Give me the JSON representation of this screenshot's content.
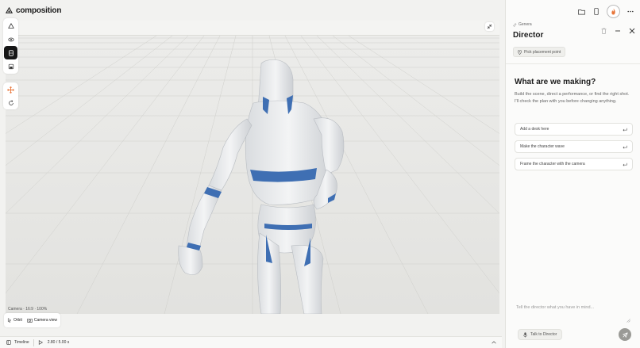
{
  "app": {
    "title": "composition"
  },
  "viewport": {
    "camera_label": "Camera · 16:9 · 100%"
  },
  "view_controls": {
    "orbit_label": "Orbit",
    "camera_view_label": "Camera view"
  },
  "timeline": {
    "label": "Timeline",
    "time": "2.80 / 5.00 s"
  },
  "panel": {
    "breadcrumb": "Genera",
    "title": "Director",
    "pick_label": "Pick placement point",
    "hero_title": "What are we making?",
    "hero_body": "Build the scene, direct a performance, or find the right shot. I'll check the plan with you before changing anything.",
    "suggestions": [
      {
        "label": "Add a desk here"
      },
      {
        "label": "Make the character wave"
      },
      {
        "label": "Frame the character with the camera"
      }
    ],
    "composer_placeholder": "Tell the director what you have in mind...",
    "talk_label": "Talk to Director"
  },
  "colors": {
    "accent": "#e8763a",
    "robot_body": "#e6e8ea",
    "robot_trim": "#3f6fb3"
  }
}
